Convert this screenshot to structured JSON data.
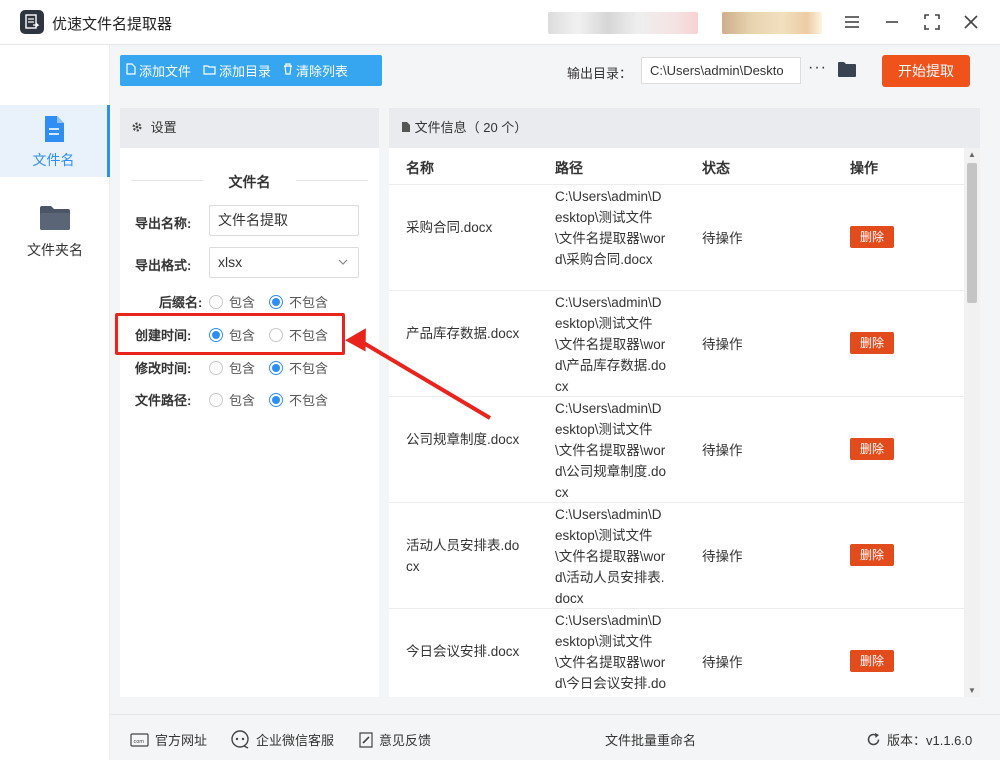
{
  "app": {
    "title": "优速文件名提取器"
  },
  "nav": [
    {
      "label": "文件名",
      "icon": "file-icon"
    },
    {
      "label": "文件夹名",
      "icon": "folder-icon"
    }
  ],
  "toolbar": {
    "add_file": "添加文件",
    "add_dir": "添加目录",
    "clear_list": "清除列表",
    "output_label": "输出目录：",
    "output_path": "C:\\Users\\admin\\Deskto",
    "more": "···",
    "start": "开始提取"
  },
  "settings": {
    "header": "设置",
    "section_title": "文件名",
    "export_name_label": "导出名称:",
    "export_name_value": "文件名提取",
    "export_format_label": "导出格式:",
    "export_format_value": "xlsx",
    "opt_include": "包含",
    "opt_exclude": "不包含",
    "options": [
      {
        "label": "后缀名:",
        "selected": "exclude"
      },
      {
        "label": "创建时间:",
        "selected": "include"
      },
      {
        "label": "修改时间:",
        "selected": "exclude"
      },
      {
        "label": "文件路径:",
        "selected": "exclude"
      }
    ]
  },
  "files": {
    "header": "文件信息（ 20 个）",
    "columns": [
      "名称",
      "路径",
      "状态",
      "操作"
    ],
    "delete_label": "删除",
    "rows": [
      {
        "name": "采购合同.docx",
        "path": "C:\\Users\\admin\\Desktop\\测试文件\\文件名提取器\\word\\采购合同.docx",
        "status": "待操作"
      },
      {
        "name": "产品库存数据.docx",
        "path": "C:\\Users\\admin\\Desktop\\测试文件\\文件名提取器\\word\\产品库存数据.docx",
        "status": "待操作"
      },
      {
        "name": "公司规章制度.docx",
        "path": "C:\\Users\\admin\\Desktop\\测试文件\\文件名提取器\\word\\公司规章制度.docx",
        "status": "待操作"
      },
      {
        "name": "活动人员安排表.docx",
        "path": "C:\\Users\\admin\\Desktop\\测试文件\\文件名提取器\\word\\活动人员安排表.docx",
        "status": "待操作"
      },
      {
        "name": "今日会议安排.docx",
        "path": "C:\\Users\\admin\\Desktop\\测试文件\\文件名提取器\\word\\今日会议安排.docx",
        "status": "待操作"
      }
    ]
  },
  "footer": {
    "website": "官方网址",
    "wechat": "企业微信客服",
    "feedback": "意见反馈",
    "batch_rename": "文件批量重命名",
    "version": "版本：v1.1.6.0"
  }
}
